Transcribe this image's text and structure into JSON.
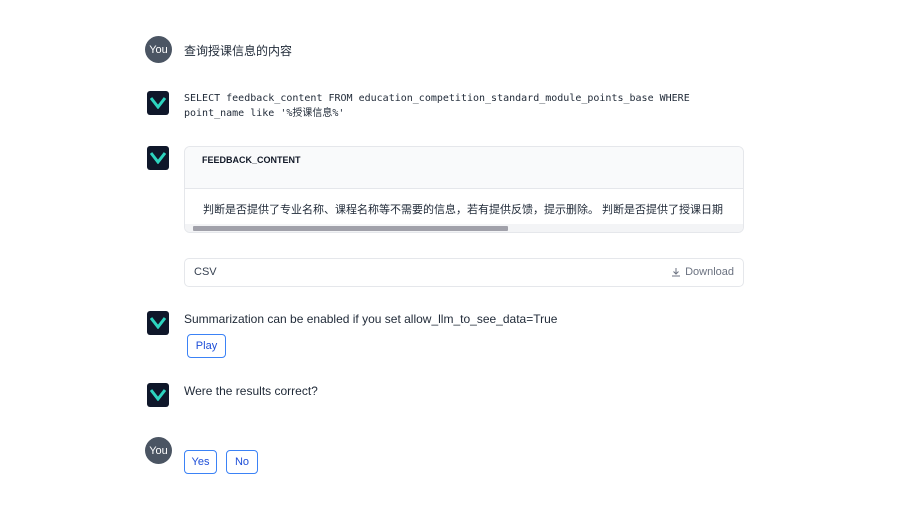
{
  "messages": {
    "question": "查询授课信息的内容",
    "sql_line1": "SELECT feedback_content FROM education_competition_standard_module_points_base WHERE",
    "sql_line2": "point_name like '%授课信息%'",
    "summary_note": "Summarization can be enabled if you set allow_llm_to_see_data=True",
    "feedback_question": "Were the results correct?"
  },
  "avatars": {
    "user_label": "You"
  },
  "table": {
    "columns": [
      "FEEDBACK_CONTENT"
    ],
    "rows": [
      [
        "判断是否提供了专业名称、课程名称等不需要的信息，若有提供反馈，提示删除。 判断是否提供了授课日期"
      ]
    ]
  },
  "export": {
    "format_label": "CSV",
    "download_label": "Download",
    "download_icon": "download-icon"
  },
  "buttons": {
    "play": "Play",
    "yes": "Yes",
    "no": "No"
  },
  "colors": {
    "accent": "#3b82f6",
    "bot_icon_bg": "#0f172a",
    "bot_icon_fg": "#2dd4bf",
    "avatar_bg": "#4b5563"
  }
}
